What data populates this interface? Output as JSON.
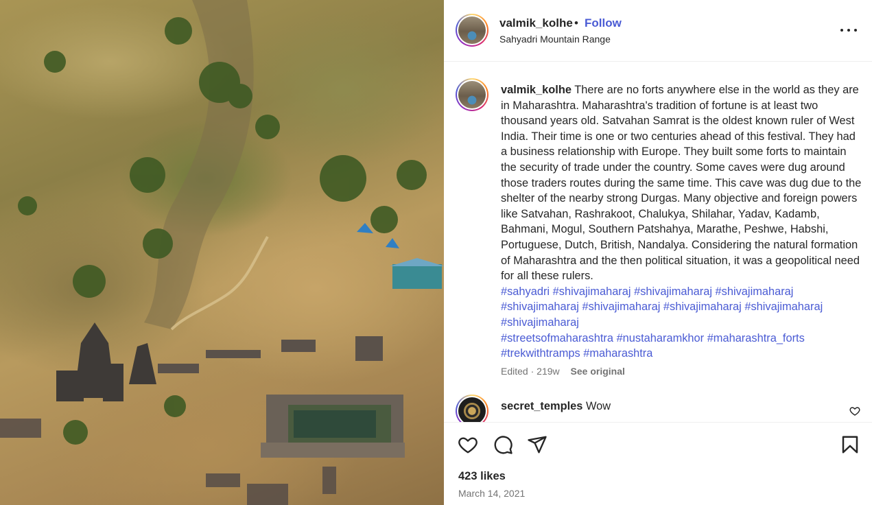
{
  "post": {
    "photo_alt": "Sahyadri mountain landscape with ancient temple and stepwell",
    "author": {
      "username": "valmik_kolhe",
      "separator": "•",
      "follow_label": "Follow",
      "location": "Sahyadri Mountain Range"
    },
    "caption": {
      "username": "valmik_kolhe",
      "text": "There are no forts anywhere else in the world as they are in Maharashtra. Maharashtra's tradition of fortune is at least two thousand years old. Satvahan Samrat is the oldest known ruler of West India. Their time is one or two centuries ahead of this festival. They had a business relationship with Europe. They built some forts to maintain the security of trade under the country. Some caves were dug around those traders routes during the same time. This cave was dug due to the shelter of the nearby strong Durgas. Many objective and foreign powers like Satvahan, Rashrakoot, Chalukya, Shilahar, Yadav, Kadamb, Bahmani, Mogul, Southern Patshahya, Marathe, Peshwe, Habshi, Portuguese, Dutch, British, Nandalya. Considering the natural formation of Maharashtra and the then political situation, it was a geopolitical need for all these rulers.",
      "hashtags": [
        "#sahyadri",
        "#shivajimaharaj",
        "#shivajimaharaj",
        "#shivajimaharaj",
        "#shivajimaharaj",
        "#shivajimaharaj",
        "#shivajimaharaj",
        "#shivajimaharaj",
        "#shivajimaharaj",
        "#streetsofmaharashtra",
        "#nustaharamkhor",
        "#maharashtra_forts",
        "#trekwithtramps",
        "#maharashtra"
      ],
      "edited_label": "Edited",
      "meta_separator": "·",
      "age": "219w",
      "see_original_label": "See original"
    },
    "comments": [
      {
        "username": "secret_temples",
        "text": "Wow"
      }
    ],
    "likes_text": "423 likes",
    "date_text": "March 14, 2021"
  },
  "icons": {
    "more": "more-options-icon",
    "like": "heart-icon",
    "comment": "comment-icon",
    "share": "share-icon",
    "save": "bookmark-icon",
    "comment_like": "small-heart-icon"
  },
  "colors": {
    "link": "#4a5bd4",
    "text": "#262626",
    "secondary": "#737373",
    "divider": "#efefef"
  }
}
